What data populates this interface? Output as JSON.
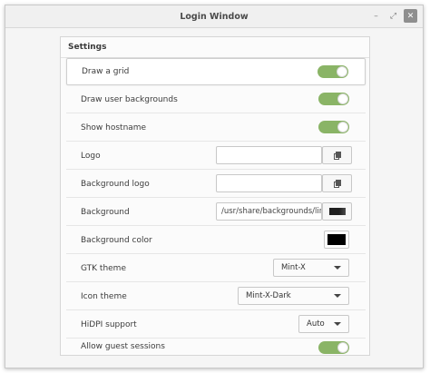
{
  "window": {
    "title": "Login Window",
    "minimize_glyph": "–",
    "maximize_glyph": "⤢",
    "close_glyph": "✕"
  },
  "settings": {
    "header": "Settings",
    "rows": {
      "draw_grid": {
        "label": "Draw a grid",
        "enabled": true
      },
      "draw_user_backgrounds": {
        "label": "Draw user backgrounds",
        "enabled": true
      },
      "show_hostname": {
        "label": "Show hostname",
        "enabled": true
      },
      "logo": {
        "label": "Logo",
        "value": ""
      },
      "background_logo": {
        "label": "Background logo",
        "value": ""
      },
      "background": {
        "label": "Background",
        "value": "/usr/share/backgrounds/linuxmint/default_background.jpg"
      },
      "background_color": {
        "label": "Background color",
        "color": "#000000"
      },
      "gtk_theme": {
        "label": "GTK theme",
        "selected": "Mint-X"
      },
      "icon_theme": {
        "label": "Icon theme",
        "selected": "Mint-X-Dark"
      },
      "hidpi": {
        "label": "HiDPI support",
        "selected": "Auto"
      },
      "guest_sessions": {
        "label": "Allow guest sessions",
        "enabled": true
      }
    }
  },
  "colors": {
    "switch_on": "#8ab466"
  }
}
